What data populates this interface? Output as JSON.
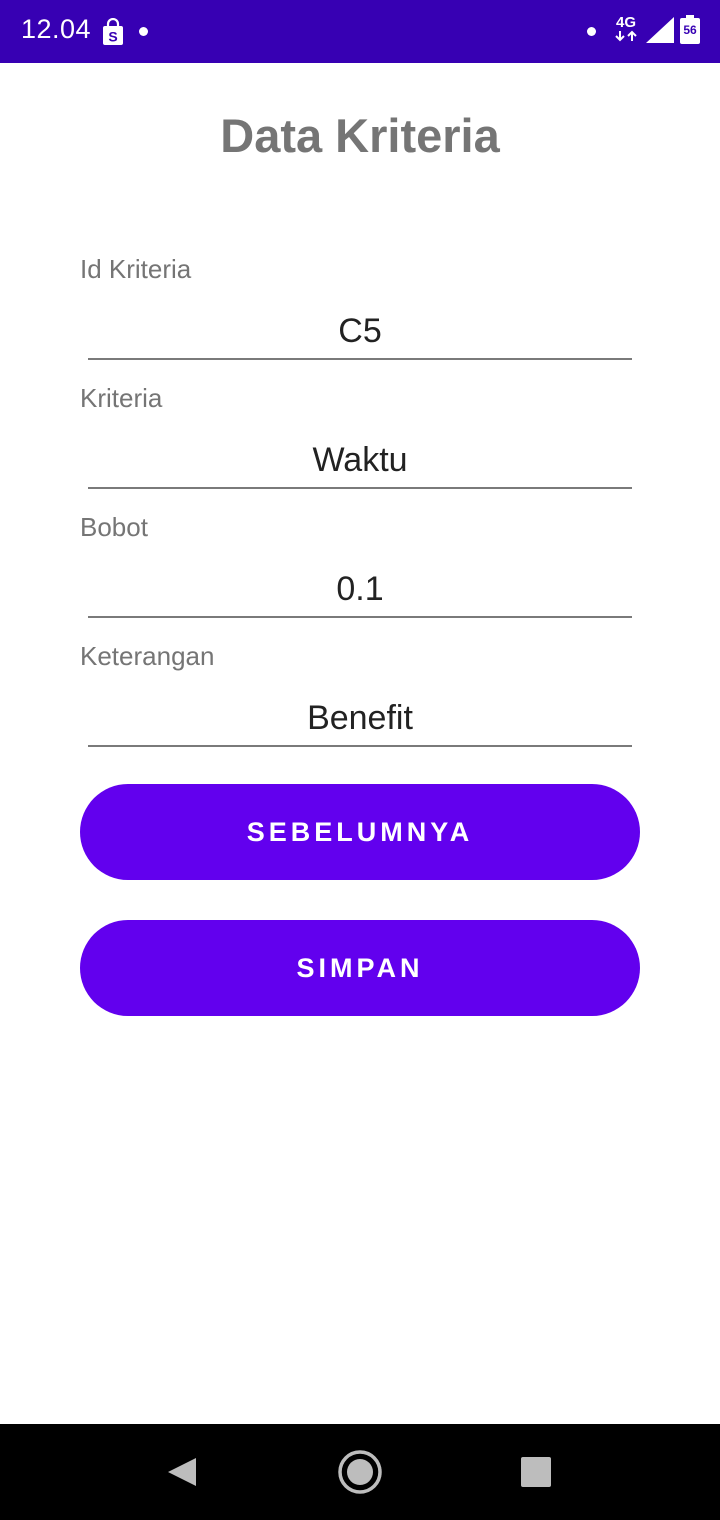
{
  "status_bar": {
    "time": "12.04",
    "network": "4G",
    "battery": "56",
    "shop_icon": "shopping-bag-icon"
  },
  "page": {
    "title": "Data Kriteria"
  },
  "fields": [
    {
      "label": "Id Kriteria",
      "value": "C5"
    },
    {
      "label": "Kriteria",
      "value": "Waktu"
    },
    {
      "label": "Bobot",
      "value": "0.1"
    },
    {
      "label": "Keterangan",
      "value": "Benefit"
    }
  ],
  "buttons": {
    "previous_label": "SEBELUMNYA",
    "save_label": "SIMPAN"
  },
  "colors": {
    "status_bar": "#3700b3",
    "primary": "#6200ee",
    "title": "#757575"
  },
  "nav_bar": {
    "back_icon": "back-triangle-icon",
    "home_icon": "home-circle-icon",
    "recents_icon": "recents-square-icon"
  }
}
